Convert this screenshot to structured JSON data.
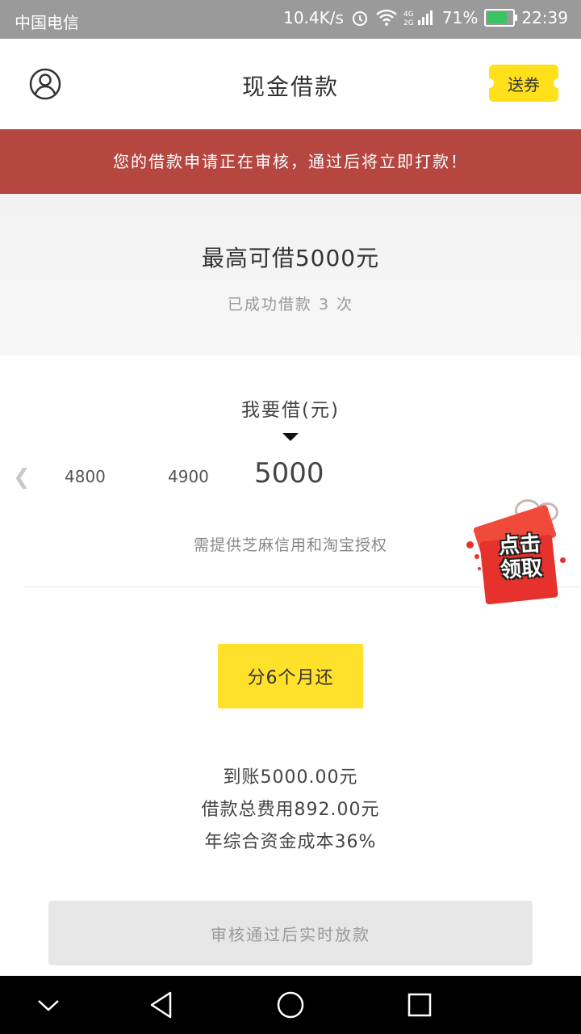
{
  "statusbar": {
    "carrier": "中国电信",
    "speed": "10.4K/s",
    "battery": "71%",
    "time": "22:39"
  },
  "header": {
    "title": "现金借款",
    "coupon_label": "送券"
  },
  "banner": {
    "text": "您的借款申请正在审核，通过后将立即打款！"
  },
  "limit": {
    "max_text": "最高可借5000元",
    "count_text": "已成功借款 3 次"
  },
  "amount_selector": {
    "label": "我要借(元)",
    "options": [
      "4800",
      "4900",
      "5000"
    ],
    "selected": "5000"
  },
  "requirement": "需提供芝麻信用和淘宝授权",
  "promo": {
    "text_line1": "点击",
    "text_line2": "领取"
  },
  "plan_button": "分6个月还",
  "summary": {
    "received": "到账5000.00元",
    "total_fee": "借款总费用892.00元",
    "annual_rate": "年综合资金成本36%"
  },
  "submit_button": "审核通过后实时放款",
  "colors": {
    "accent_yellow": "#ffe02a",
    "banner_red": "#b64640"
  }
}
